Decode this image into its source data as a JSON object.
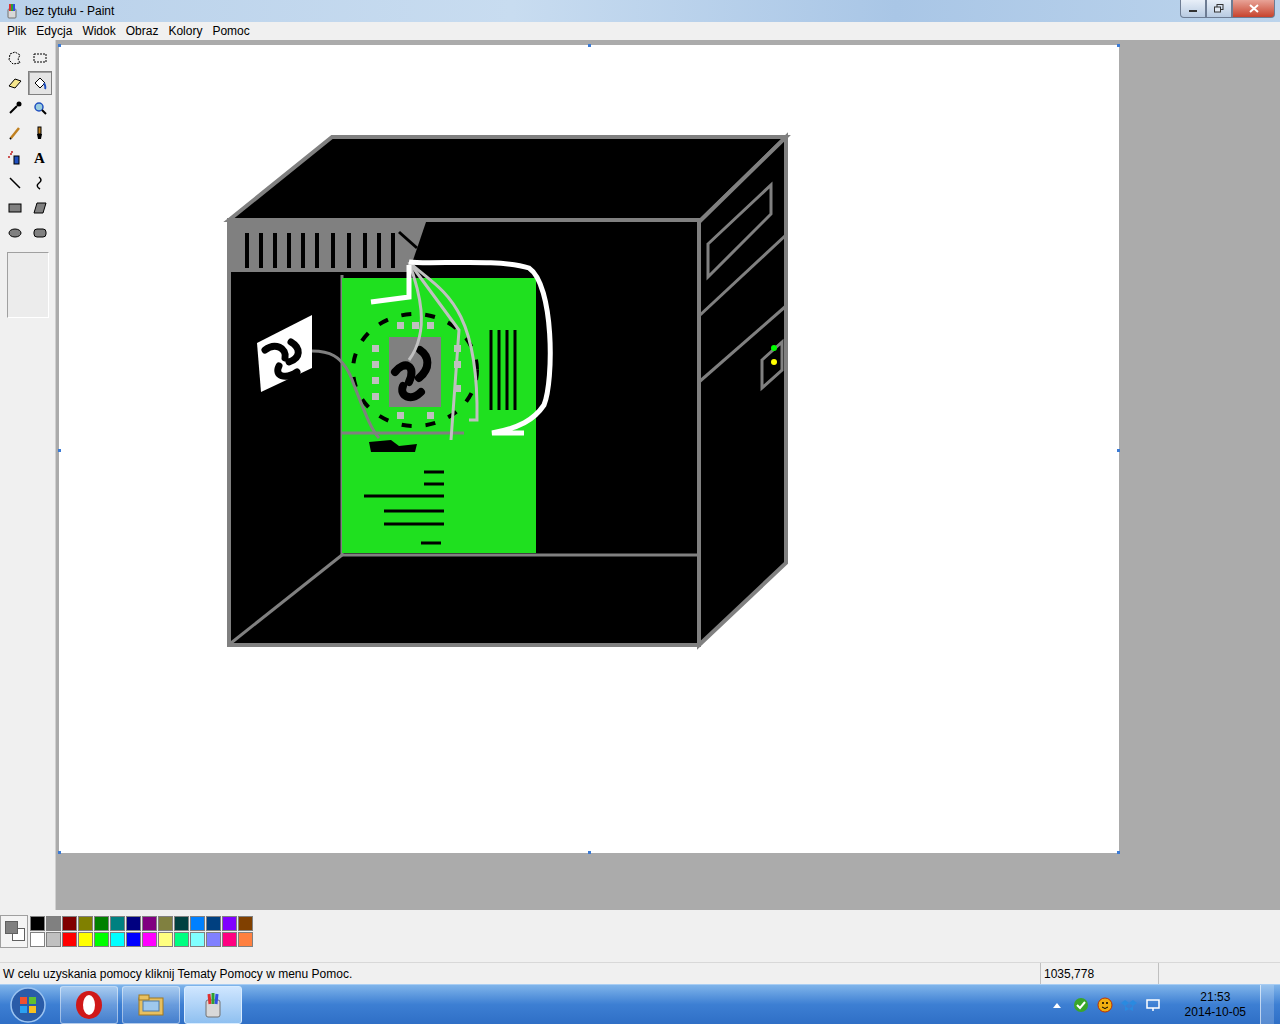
{
  "window": {
    "title": "bez tytułu - Paint"
  },
  "menu": [
    "Plik",
    "Edycja",
    "Widok",
    "Obraz",
    "Kolory",
    "Pomoc"
  ],
  "tools": [
    {
      "kind": "free-select",
      "label": "",
      "selected": false
    },
    {
      "kind": "select",
      "label": "",
      "selected": false
    },
    {
      "kind": "eraser",
      "label": "",
      "selected": false
    },
    {
      "kind": "fill",
      "label": "",
      "selected": true
    },
    {
      "kind": "picker",
      "label": "",
      "selected": false
    },
    {
      "kind": "magnifier",
      "label": "",
      "selected": false
    },
    {
      "kind": "pencil",
      "label": "",
      "selected": false
    },
    {
      "kind": "brush",
      "label": "",
      "selected": false
    },
    {
      "kind": "airbrush",
      "label": "",
      "selected": false
    },
    {
      "kind": "text",
      "label": "A",
      "selected": false
    },
    {
      "kind": "line",
      "label": "",
      "selected": false
    },
    {
      "kind": "curve",
      "label": "",
      "selected": false
    },
    {
      "kind": "rect",
      "label": "",
      "selected": false
    },
    {
      "kind": "polygon",
      "label": "",
      "selected": false
    },
    {
      "kind": "ellipse",
      "label": "",
      "selected": false
    },
    {
      "kind": "rounded-rect",
      "label": "",
      "selected": false
    }
  ],
  "palette": {
    "foreground": "#808080",
    "background": "#ffffff",
    "colors": [
      {
        "color": "#000000"
      },
      {
        "color": "#808080"
      },
      {
        "color": "#800000"
      },
      {
        "color": "#808000"
      },
      {
        "color": "#008000"
      },
      {
        "color": "#008080"
      },
      {
        "color": "#000080"
      },
      {
        "color": "#800080"
      },
      {
        "color": "#808040"
      },
      {
        "color": "#004040"
      },
      {
        "color": "#0080ff"
      },
      {
        "color": "#004080"
      },
      {
        "color": "#8000ff"
      },
      {
        "color": "#804000"
      },
      {
        "color": "#ffffff"
      },
      {
        "color": "#c0c0c0"
      },
      {
        "color": "#ff0000"
      },
      {
        "color": "#ffff00"
      },
      {
        "color": "#00ff00"
      },
      {
        "color": "#00ffff"
      },
      {
        "color": "#0000ff"
      },
      {
        "color": "#ff00ff"
      },
      {
        "color": "#ffff80"
      },
      {
        "color": "#00ff80"
      },
      {
        "color": "#80ffff"
      },
      {
        "color": "#8080ff"
      },
      {
        "color": "#ff0080"
      },
      {
        "color": "#ff8040"
      }
    ]
  },
  "status_bar": {
    "message": "W celu uzyskania pomocy kliknij Tematy Pomocy w menu Pomoc.",
    "coordinates": "1035,778"
  },
  "taskbar": {
    "apps": [
      {
        "kind": "opera",
        "selected": false
      },
      {
        "kind": "explorer",
        "selected": false
      },
      {
        "kind": "paint",
        "selected": true
      }
    ],
    "tray": [
      {
        "kind": "arrow"
      },
      {
        "kind": "check",
        "color": "#3aa62a"
      },
      {
        "kind": "smile",
        "color": "#f0b010"
      },
      {
        "kind": "dropbox",
        "color": "#2a8ae0"
      },
      {
        "kind": "network",
        "color": "#ffffff"
      }
    ],
    "clock": {
      "time": "21:53",
      "date": "2014-10-05"
    }
  }
}
